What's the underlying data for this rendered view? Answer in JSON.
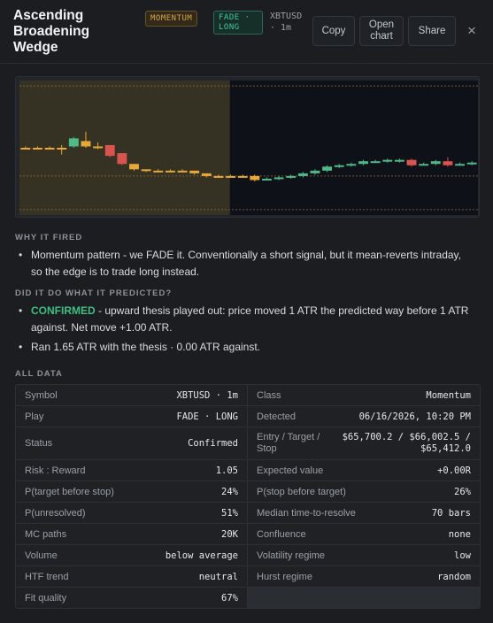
{
  "header": {
    "title": "Ascending Broadening Wedge",
    "badge_category": "MOMENTUM",
    "badge_play": "FADE · LONG",
    "symbol": "XBTUSD · 1m",
    "copy_label": "Copy",
    "open_chart_label": "Open chart",
    "share_label": "Share",
    "close_label": "×"
  },
  "colors": {
    "up": "#4fb98a",
    "down": "#d9534f",
    "pattern_candle": "#e8a838",
    "highlight": "#353224",
    "grid_dotted": "#8a6a3a",
    "chart_bg": "#0e1218"
  },
  "chart_data": {
    "type": "candlestick",
    "note_colors": [
      "pattern",
      "up",
      "down"
    ],
    "pattern_range": [
      0,
      16
    ],
    "candles": [
      {
        "o": 0.5,
        "c": 0.5,
        "h": 0.51,
        "l": 0.49,
        "k": "pattern"
      },
      {
        "o": 0.5,
        "c": 0.5,
        "h": 0.51,
        "l": 0.49,
        "k": "pattern"
      },
      {
        "o": 0.5,
        "c": 0.5,
        "h": 0.51,
        "l": 0.49,
        "k": "pattern"
      },
      {
        "o": 0.5,
        "c": 0.5,
        "h": 0.52,
        "l": 0.45,
        "k": "pattern"
      },
      {
        "o": 0.51,
        "c": 0.57,
        "h": 0.58,
        "l": 0.5,
        "k": "up"
      },
      {
        "o": 0.55,
        "c": 0.51,
        "h": 0.62,
        "l": 0.5,
        "k": "pattern"
      },
      {
        "o": 0.51,
        "c": 0.5,
        "h": 0.54,
        "l": 0.49,
        "k": "pattern"
      },
      {
        "o": 0.52,
        "c": 0.44,
        "h": 0.52,
        "l": 0.43,
        "k": "down"
      },
      {
        "o": 0.46,
        "c": 0.38,
        "h": 0.46,
        "l": 0.37,
        "k": "down"
      },
      {
        "o": 0.38,
        "c": 0.34,
        "h": 0.38,
        "l": 0.33,
        "k": "pattern"
      },
      {
        "o": 0.34,
        "c": 0.33,
        "h": 0.34,
        "l": 0.32,
        "k": "pattern"
      },
      {
        "o": 0.33,
        "c": 0.33,
        "h": 0.34,
        "l": 0.32,
        "k": "pattern"
      },
      {
        "o": 0.33,
        "c": 0.33,
        "h": 0.34,
        "l": 0.32,
        "k": "pattern"
      },
      {
        "o": 0.33,
        "c": 0.33,
        "h": 0.34,
        "l": 0.32,
        "k": "pattern"
      },
      {
        "o": 0.33,
        "c": 0.31,
        "h": 0.33,
        "l": 0.3,
        "k": "pattern"
      },
      {
        "o": 0.31,
        "c": 0.29,
        "h": 0.31,
        "l": 0.28,
        "k": "pattern"
      },
      {
        "o": 0.29,
        "c": 0.29,
        "h": 0.3,
        "l": 0.28,
        "k": "pattern"
      },
      {
        "o": 0.29,
        "c": 0.29,
        "h": 0.3,
        "l": 0.28,
        "k": "pattern"
      },
      {
        "o": 0.29,
        "c": 0.29,
        "h": 0.3,
        "l": 0.28,
        "k": "pattern"
      },
      {
        "o": 0.29,
        "c": 0.26,
        "h": 0.3,
        "l": 0.25,
        "k": "pattern"
      },
      {
        "o": 0.27,
        "c": 0.27,
        "h": 0.28,
        "l": 0.26,
        "k": "up"
      },
      {
        "o": 0.27,
        "c": 0.28,
        "h": 0.29,
        "l": 0.26,
        "k": "up"
      },
      {
        "o": 0.28,
        "c": 0.29,
        "h": 0.3,
        "l": 0.27,
        "k": "up"
      },
      {
        "o": 0.29,
        "c": 0.31,
        "h": 0.32,
        "l": 0.28,
        "k": "up"
      },
      {
        "o": 0.31,
        "c": 0.33,
        "h": 0.34,
        "l": 0.3,
        "k": "up"
      },
      {
        "o": 0.33,
        "c": 0.36,
        "h": 0.37,
        "l": 0.32,
        "k": "up"
      },
      {
        "o": 0.36,
        "c": 0.37,
        "h": 0.38,
        "l": 0.35,
        "k": "up"
      },
      {
        "o": 0.37,
        "c": 0.38,
        "h": 0.39,
        "l": 0.36,
        "k": "up"
      },
      {
        "o": 0.38,
        "c": 0.4,
        "h": 0.41,
        "l": 0.37,
        "k": "up"
      },
      {
        "o": 0.4,
        "c": 0.4,
        "h": 0.41,
        "l": 0.39,
        "k": "up"
      },
      {
        "o": 0.4,
        "c": 0.41,
        "h": 0.42,
        "l": 0.39,
        "k": "up"
      },
      {
        "o": 0.41,
        "c": 0.4,
        "h": 0.42,
        "l": 0.39,
        "k": "up"
      },
      {
        "o": 0.41,
        "c": 0.37,
        "h": 0.42,
        "l": 0.36,
        "k": "down"
      },
      {
        "o": 0.38,
        "c": 0.38,
        "h": 0.39,
        "l": 0.37,
        "k": "up"
      },
      {
        "o": 0.38,
        "c": 0.4,
        "h": 0.41,
        "l": 0.37,
        "k": "up"
      },
      {
        "o": 0.4,
        "c": 0.37,
        "h": 0.43,
        "l": 0.36,
        "k": "down"
      },
      {
        "o": 0.38,
        "c": 0.38,
        "h": 0.39,
        "l": 0.37,
        "k": "up"
      },
      {
        "o": 0.38,
        "c": 0.39,
        "h": 0.4,
        "l": 0.37,
        "k": "up"
      }
    ],
    "levels": [
      0.96,
      0.29,
      0.04
    ]
  },
  "why": {
    "heading": "WHY IT FIRED",
    "text": "Momentum pattern - we FADE it. Conventionally a short signal, but it mean-reverts intraday, so the edge is to trade long instead."
  },
  "did": {
    "heading": "DID IT DO WHAT IT PREDICTED?",
    "status_word": "CONFIRMED",
    "status_text": " - upward thesis played out: price moved 1 ATR the predicted way before 1 ATR against. Net move +1.00 ATR.",
    "run_text": "Ran 1.65 ATR with the thesis · 0.00 ATR against."
  },
  "all_data": {
    "heading": "ALL DATA",
    "rows": [
      {
        "k1": "Symbol",
        "v1": "XBTUSD · 1m",
        "k2": "Class",
        "v2": "Momentum"
      },
      {
        "k1": "Play",
        "v1": "FADE · LONG",
        "k2": "Detected",
        "v2": "06/16/2026, 10:20 PM"
      },
      {
        "k1": "Status",
        "v1": "Confirmed",
        "k2": "Entry / Target / Stop",
        "v2": "$65,700.2 / $66,002.5 / $65,412.0"
      },
      {
        "k1": "Risk : Reward",
        "v1": "1.05",
        "k2": "Expected value",
        "v2": "+0.00R"
      },
      {
        "k1": "P(target before stop)",
        "v1": "24%",
        "k2": "P(stop before target)",
        "v2": "26%"
      },
      {
        "k1": "P(unresolved)",
        "v1": "51%",
        "k2": "Median time-to-resolve",
        "v2": "70 bars"
      },
      {
        "k1": "MC paths",
        "v1": "20K",
        "k2": "Confluence",
        "v2": "none"
      },
      {
        "k1": "Volume",
        "v1": "below average",
        "k2": "Volatility regime",
        "v2": "low"
      },
      {
        "k1": "HTF trend",
        "v1": "neutral",
        "k2": "Hurst regime",
        "v2": "random"
      },
      {
        "k1": "Fit quality",
        "v1": "67%"
      }
    ]
  }
}
